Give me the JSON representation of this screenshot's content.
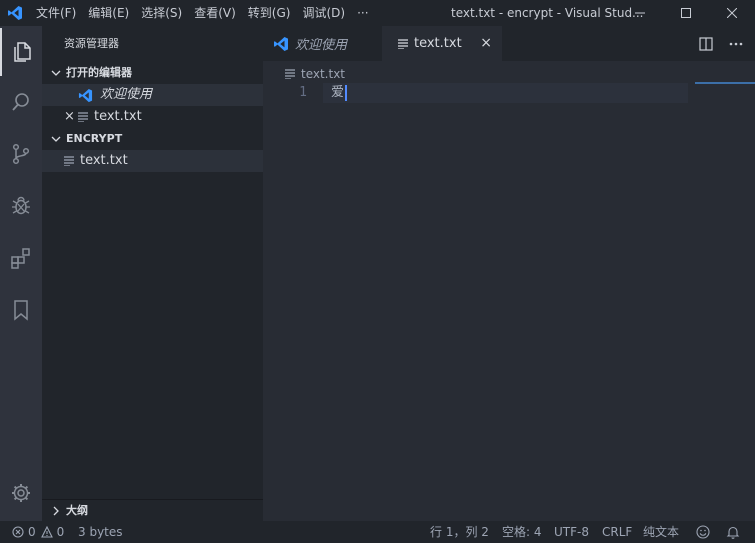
{
  "titlebar": {
    "menu": [
      {
        "label": "文件(F)"
      },
      {
        "label": "编辑(E)"
      },
      {
        "label": "选择(S)"
      },
      {
        "label": "查看(V)"
      },
      {
        "label": "转到(G)"
      },
      {
        "label": "调试(D)"
      },
      {
        "label": "···"
      }
    ],
    "window_title": "text.txt - encrypt - Visual Stud..."
  },
  "sidebar": {
    "title": "资源管理器",
    "open_editors": {
      "header": "打开的编辑器",
      "items": [
        {
          "label": "欢迎使用",
          "icon": "vscode-logo-icon"
        },
        {
          "label": "text.txt",
          "icon": "text-file-icon",
          "close": "×"
        }
      ]
    },
    "folder": {
      "header": "ENCRYPT",
      "items": [
        {
          "label": "text.txt",
          "icon": "text-file-icon"
        }
      ]
    },
    "outline": {
      "header": "大纲"
    }
  },
  "tabs": [
    {
      "label": "欢迎使用",
      "active": false
    },
    {
      "label": "text.txt",
      "active": true,
      "close": "×"
    }
  ],
  "editor": {
    "breadcrumb": "text.txt",
    "lines": [
      {
        "number": "1",
        "text": "爱"
      }
    ]
  },
  "statusbar": {
    "errors": "0",
    "warnings": "0",
    "size": "3 bytes",
    "position": "行 1，列 2",
    "indent": "空格: 4",
    "encoding": "UTF-8",
    "eol": "CRLF",
    "language": "纯文本"
  },
  "colors": {
    "accent": "#3794ff",
    "titlebar_bg": "#21252b",
    "activitybar_bg": "#2f333d",
    "editor_bg": "#282c34",
    "cursor": "#528bff"
  }
}
